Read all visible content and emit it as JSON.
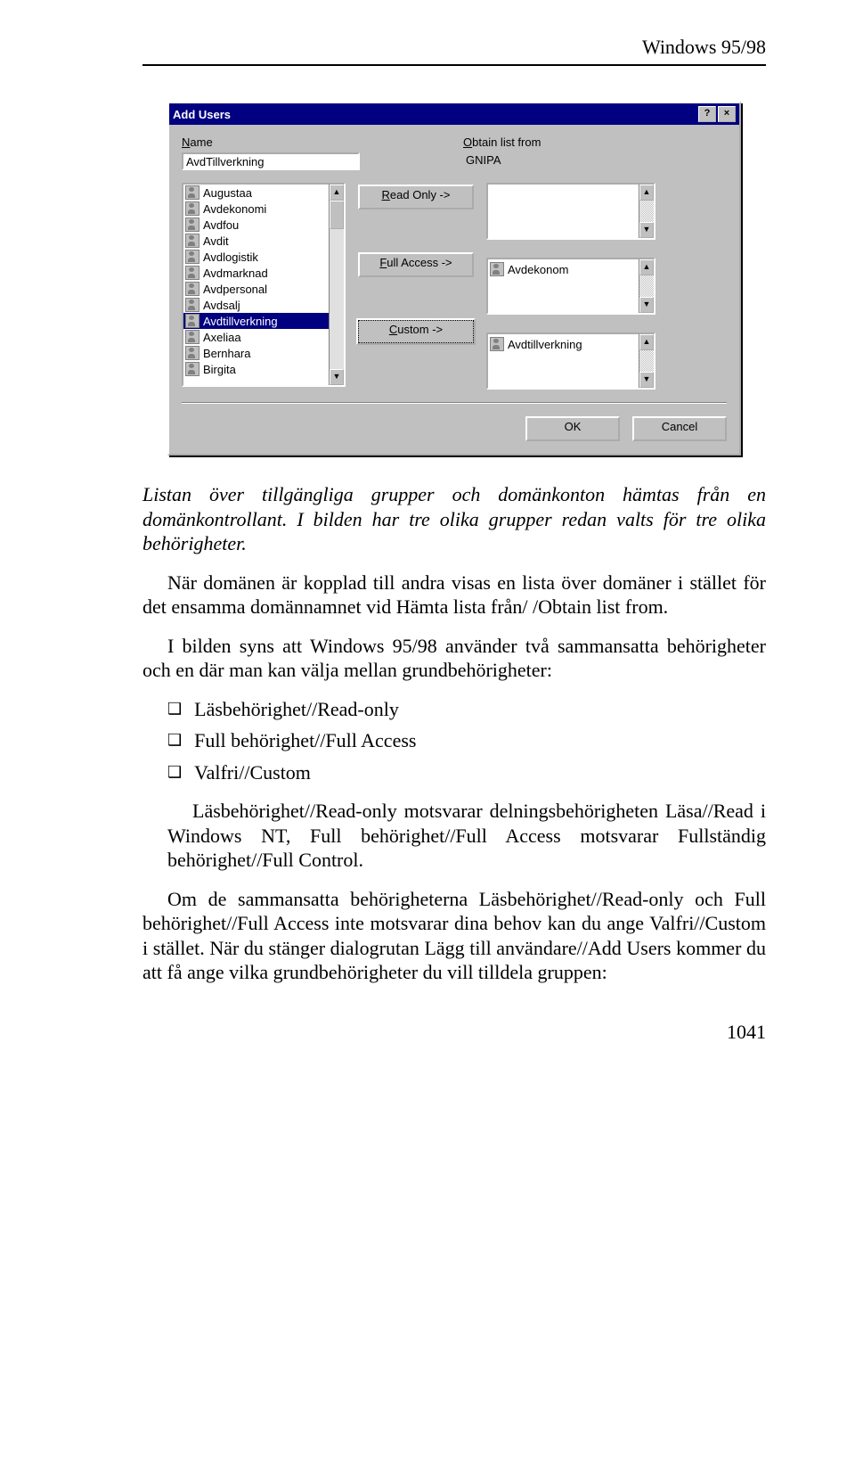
{
  "header": "Windows 95/98",
  "dialog": {
    "title": "Add Users",
    "name_label": "Name",
    "name_value": "AvdTillverkning",
    "obtain_label": "Obtain list from",
    "obtain_value": "GNIPA",
    "users": [
      "Augustaa",
      "Avdekonomi",
      "Avdfou",
      "Avdit",
      "Avdlogistik",
      "Avdmarknad",
      "Avdpersonal",
      "Avdsalj",
      "Avdtillverkning",
      "Axeliaa",
      "Bernhara",
      "Birgita"
    ],
    "selected_user_index": 8,
    "btn_readonly": "Read Only ->",
    "btn_fullaccess": "Full Access ->",
    "btn_custom": "Custom ->",
    "readonly_list": [],
    "fullaccess_list": [
      "Avdekonom"
    ],
    "custom_list": [
      "Avdtillverkning"
    ],
    "btn_ok": "OK",
    "btn_cancel": "Cancel"
  },
  "text": {
    "p1": "Listan över tillgängliga grupper och domänkonton hämtas från en domänkontrollant. I bilden har tre olika grupper redan valts för tre olika behörigheter.",
    "p2a": "När domänen är kopplad till andra visas en lista över domäner i stället för det ensamma domännamnet vid Hämta lista från/ /Obtain list from.",
    "p2b": "I bilden syns att Windows 95/98 använder två sammansatta behörigheter och en där man kan välja mellan grundbehörigheter:",
    "bullets": [
      "Läsbehörighet//Read-only",
      "Full behörighet//Full Access",
      "Valfri//Custom"
    ],
    "p3": "Läsbehörighet//Read-only motsvarar delningsbehörigheten Läsa//Read i Windows NT, Full behörighet//Full Access motsvarar Fullständig behörighet//Full Control.",
    "p4": "Om de sammansatta behörigheterna Läsbehörighet//Read-only och Full behörighet//Full Access inte motsvarar dina behov kan du ange Valfri//Custom i stället. När du stänger dialogrutan Lägg till användare//Add Users kommer du att få ange vilka grundbehörigheter du vill tilldela gruppen:"
  },
  "pagenum": "1041"
}
